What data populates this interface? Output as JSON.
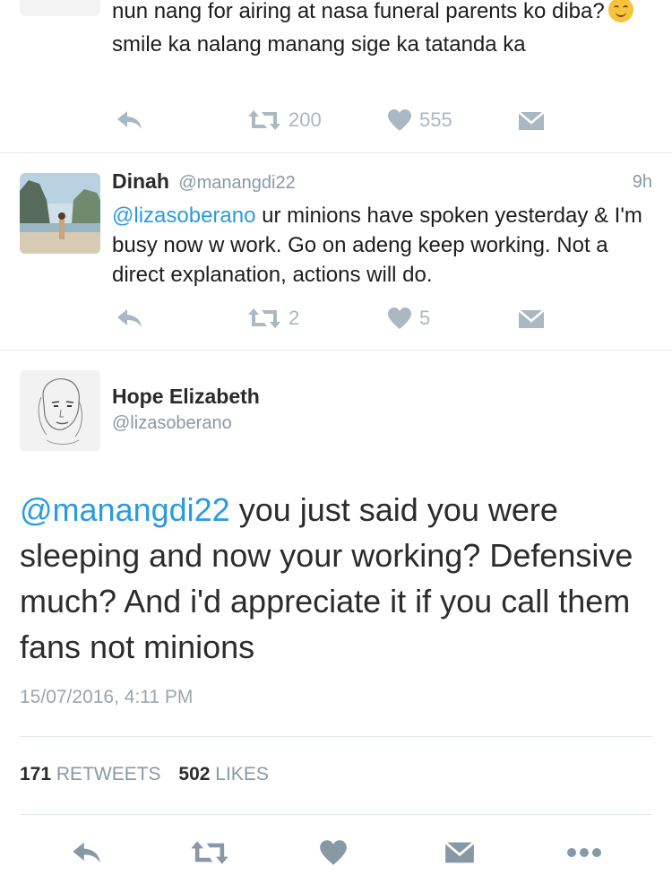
{
  "tweet1": {
    "text_part1": "nun nang for airing at nasa funeral parents ko diba?",
    "emoji": "smiling-face-emoji",
    "text_part2": "smile ka nalang manang sige ka tatanda ka",
    "retweets": "200",
    "likes": "555"
  },
  "tweet2": {
    "name": "Dinah",
    "handle": "@manangdi22",
    "time": "9h",
    "mention": "@lizasoberano",
    "text": "ur minions have spoken yesterday & I'm busy now w work. Go on adeng keep working. Not a direct explanation, actions will do.",
    "retweets": "2",
    "likes": "5"
  },
  "main_tweet": {
    "name": "Hope Elizabeth",
    "handle": "@lizasoberano",
    "mention": "@manangdi22",
    "text": "you just said you were sleeping and now your working? Defensive much? And i'd appreciate it if you call them fans not minions",
    "timestamp": "15/07/2016, 4:11 PM",
    "retweet_count": "171",
    "retweet_label": "RETWEETS",
    "like_count": "502",
    "like_label": "LIKES"
  },
  "colors": {
    "link": "#2b9be0",
    "icon": "#aab8c2",
    "icon_dark": "#8899a6",
    "divider": "#e1e8ed"
  }
}
